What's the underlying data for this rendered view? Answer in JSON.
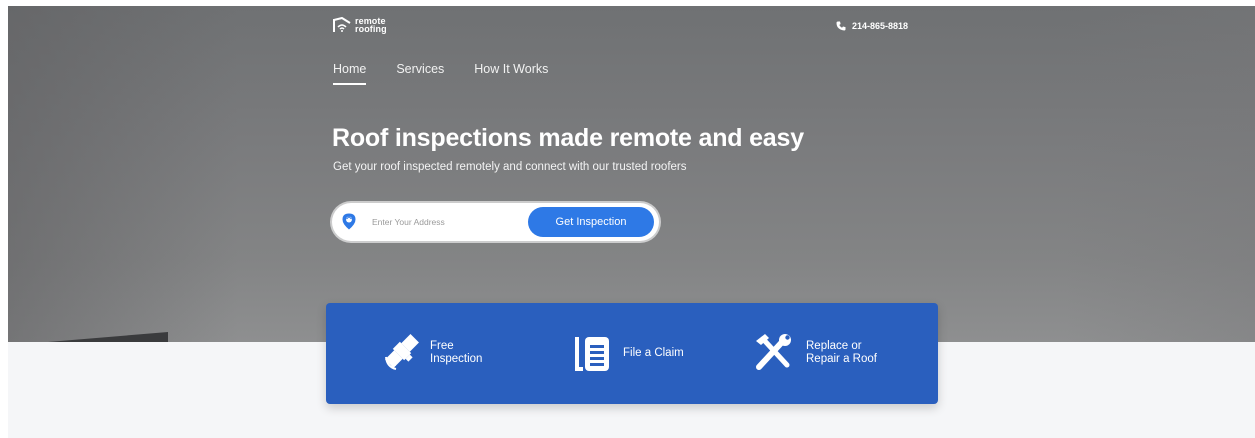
{
  "brand": {
    "line1": "remote",
    "line2": "roofing"
  },
  "header": {
    "phone_icon": "phone-icon",
    "phone_number": "214-865-8818"
  },
  "nav": {
    "items": [
      {
        "label": "Home",
        "active": true
      },
      {
        "label": "Services",
        "active": false
      },
      {
        "label": "How It Works",
        "active": false
      }
    ]
  },
  "hero": {
    "title": "Roof inspections made remote and easy",
    "subtitle": "Get your roof inspected remotely and connect with our trusted roofers"
  },
  "search": {
    "icon": "location-pin-icon",
    "placeholder": "Enter Your Address",
    "value": "",
    "button_label": "Get Inspection"
  },
  "features": [
    {
      "icon": "satellite-icon",
      "line1": "Free",
      "line2": "Inspection"
    },
    {
      "icon": "document-icon",
      "line1": "File a Claim",
      "line2": ""
    },
    {
      "icon": "tools-icon",
      "line1": "Replace or",
      "line2": "Repair a Roof"
    }
  ],
  "colors": {
    "accent": "#2e79e6",
    "feature_bar": "#2a5fbe",
    "hero_overlay": "#7a7b7d",
    "section_bg": "#f5f6f8"
  }
}
